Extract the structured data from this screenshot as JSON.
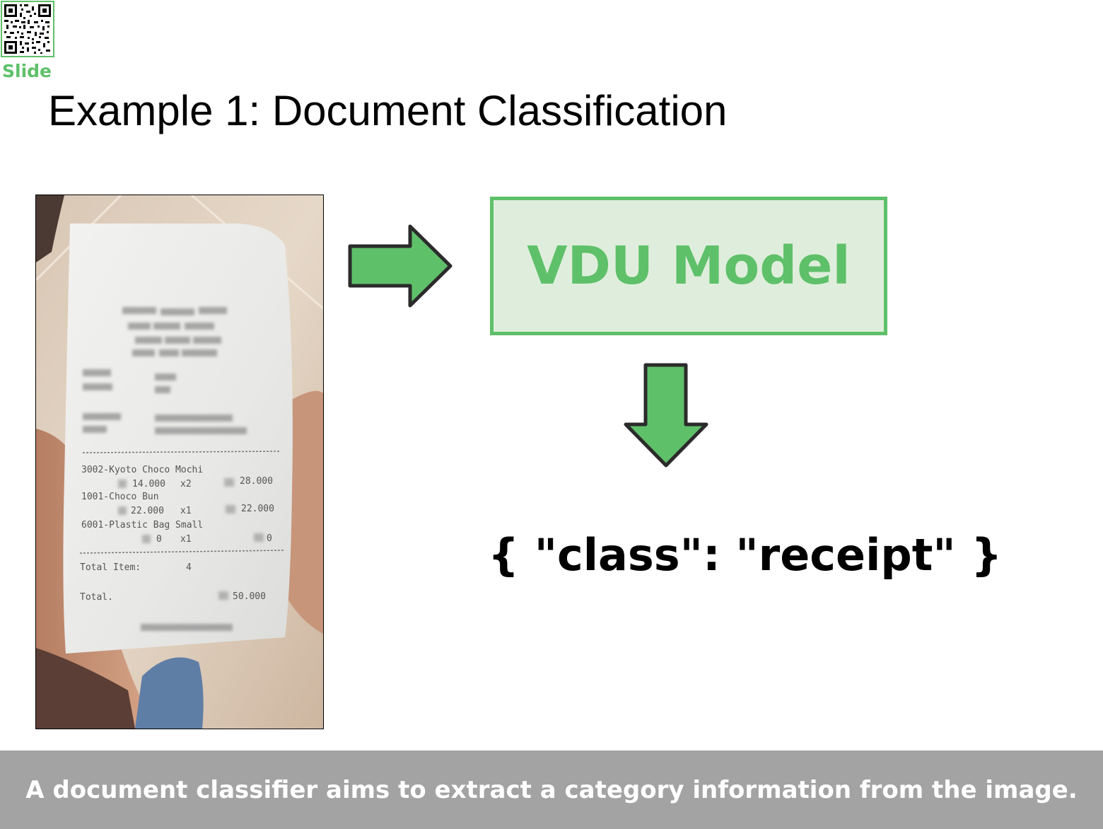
{
  "slide_label": "Slide",
  "title": "Example 1: Document Classification",
  "model_box": {
    "label": "VDU Model"
  },
  "output": {
    "text": "{ \"class\": \"receipt\" }"
  },
  "caption": "A document classifier aims to extract a category information from the image.",
  "receipt": {
    "lines": [
      {
        "item": "3002-Kyoto Choco Mochi",
        "price": "14.000",
        "qty": "x2",
        "total": "28.000"
      },
      {
        "item": "1001-Choco Bun",
        "price": "22.000",
        "qty": "x1",
        "total": "22.000"
      },
      {
        "item": "6001-Plastic Bag Small",
        "price": "0",
        "qty": "x1",
        "total": "0"
      }
    ],
    "total_items_label": "Total Item:",
    "total_items_value": "4",
    "total_label": "Total.",
    "total_value": "50.000"
  },
  "colors": {
    "accent_green": "#5fc06a",
    "box_fill": "#dfeedc",
    "caption_bg": "#a3a3a3"
  },
  "icons": [
    "qr-code-icon",
    "arrow-right-icon",
    "arrow-down-icon"
  ]
}
